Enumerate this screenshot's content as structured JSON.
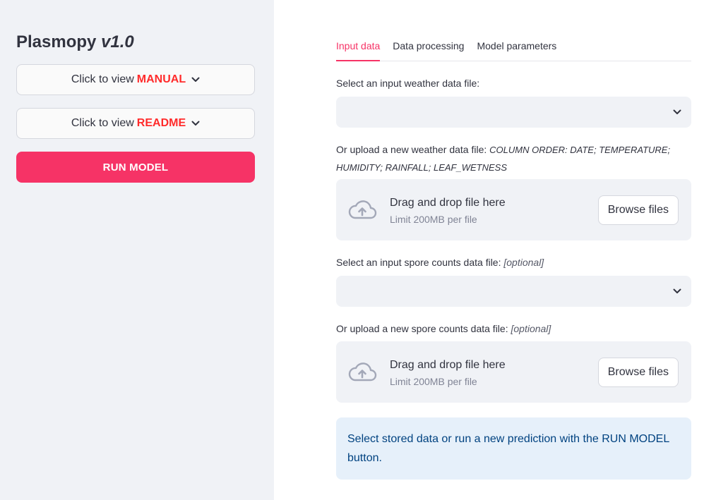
{
  "sidebar": {
    "title_main": "Plasmopy",
    "title_version": "v1.0",
    "manual_prefix": "Click to view",
    "manual_accent": "MANUAL",
    "readme_prefix": "Click to view",
    "readme_accent": "README",
    "run_label": "RUN MODEL"
  },
  "tabs": [
    {
      "label": "Input data",
      "active": true
    },
    {
      "label": "Data processing",
      "active": false
    },
    {
      "label": "Model parameters",
      "active": false
    }
  ],
  "weather": {
    "select_label": "Select an input weather data file:",
    "select_value": "",
    "upload_label": "Or upload a new weather data file:",
    "upload_hint_line1": "COLUMN ORDER: DATE; TEMPERATURE;",
    "upload_hint_line2": "HUMIDITY; RAINFALL; LEAF_WETNESS"
  },
  "spore": {
    "select_label": "Select an input spore counts data file:",
    "select_optional": "[optional]",
    "select_value": "",
    "upload_label": "Or upload a new spore counts data file:",
    "upload_optional": "[optional]"
  },
  "uploader": {
    "drop_text": "Drag and drop file here",
    "limit_text": "Limit 200MB per file",
    "browse_label": "Browse files"
  },
  "info_text": "Select stored data or run a new prediction with the RUN MODEL button.",
  "colors": {
    "accent": "#f63366",
    "accent_text": "#ff2b2b",
    "sidebar_bg": "#f0f2f6",
    "info_bg": "#e6f0fa",
    "info_text": "#004280"
  }
}
